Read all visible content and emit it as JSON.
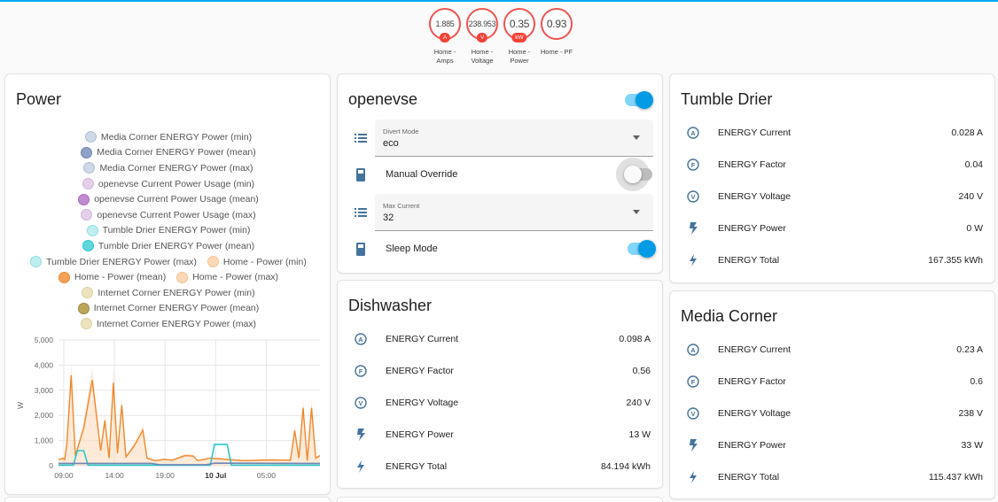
{
  "badges": [
    {
      "value": "1.885",
      "unit": "A",
      "label": "Home -\nAmps"
    },
    {
      "value": "238.953",
      "unit": "V",
      "label": "Home -\nVoltage"
    },
    {
      "value": "0.35",
      "unit": "kW",
      "label": "Home -\nPower"
    },
    {
      "value": "0.93",
      "unit": "",
      "label": "Home - PF"
    }
  ],
  "power": {
    "title": "Power",
    "legend": [
      {
        "label": "Media Corner ENERGY Power (min)",
        "fill": "#cfd8e6",
        "stroke": "#b0bfd6"
      },
      {
        "label": "Media Corner ENERGY Power (mean)",
        "fill": "#8ea2c6",
        "stroke": "#6f86b3"
      },
      {
        "label": "Media Corner ENERGY Power (max)",
        "fill": "#cfd8e6",
        "stroke": "#b0bfd6"
      },
      {
        "label": "openevse Current Power Usage (min)",
        "fill": "#e4cfe9",
        "stroke": "#d3b4dc"
      },
      {
        "label": "openevse Current Power Usage (mean)",
        "fill": "#c28ad0",
        "stroke": "#a96bb9"
      },
      {
        "label": "openevse Current Power Usage (max)",
        "fill": "#e4cfe9",
        "stroke": "#d3b4dc"
      },
      {
        "label": "Tumble Drier ENERGY Power (min)",
        "fill": "#bfeef0",
        "stroke": "#8fdde1"
      },
      {
        "label": "Tumble Drier ENERGY Power (mean)",
        "fill": "#5fd7dc",
        "stroke": "#2bc7cd"
      },
      {
        "label": "Tumble Drier ENERGY Power (max)",
        "fill": "#bfeef0",
        "stroke": "#8fdde1"
      },
      {
        "label": "Home - Power (min)",
        "fill": "#fbd8b8",
        "stroke": "#f7c190"
      },
      {
        "label": "Home - Power (mean)",
        "fill": "#f6a15a",
        "stroke": "#f0882e"
      },
      {
        "label": "Home - Power (max)",
        "fill": "#fbd8b8",
        "stroke": "#f7c190"
      },
      {
        "label": "Internet Corner ENERGY Power (min)",
        "fill": "#ece3bf",
        "stroke": "#ddd09a"
      },
      {
        "label": "Internet Corner ENERGY Power (mean)",
        "fill": "#bda55a",
        "stroke": "#9c873d"
      },
      {
        "label": "Internet Corner ENERGY Power (max)",
        "fill": "#ece3bf",
        "stroke": "#ddd09a"
      }
    ]
  },
  "chart_data": {
    "type": "line",
    "ylabel": "W",
    "ylim": [
      0,
      5000
    ],
    "yticks": [
      "0",
      "1,000",
      "2,000",
      "3,000",
      "4,000",
      "5,000"
    ],
    "xticks": [
      {
        "label": "09:00",
        "bold": false
      },
      {
        "label": "14:00",
        "bold": false
      },
      {
        "label": "19:00",
        "bold": false
      },
      {
        "label": "10 Jul",
        "bold": true
      },
      {
        "label": "05:00",
        "bold": false
      }
    ],
    "grid": true,
    "series": [
      {
        "name": "Home - Power (mean)",
        "color": "#f0882e",
        "points": [
          [
            0,
            250
          ],
          [
            0.05,
            260
          ],
          [
            0.1,
            300
          ],
          [
            0.15,
            250
          ],
          [
            0.2,
            900
          ],
          [
            0.3,
            3600
          ],
          [
            0.4,
            400
          ],
          [
            0.6,
            1500
          ],
          [
            0.8,
            3400
          ],
          [
            1.0,
            600
          ],
          [
            1.1,
            1800
          ],
          [
            1.2,
            300
          ],
          [
            1.3,
            3300
          ],
          [
            1.4,
            500
          ],
          [
            1.5,
            2400
          ],
          [
            1.6,
            350
          ],
          [
            1.8,
            800
          ],
          [
            2.0,
            1400
          ],
          [
            2.1,
            300
          ],
          [
            2.3,
            200
          ],
          [
            2.5,
            250
          ],
          [
            2.7,
            220
          ],
          [
            3.0,
            400
          ],
          [
            3.2,
            380
          ],
          [
            3.3,
            200
          ],
          [
            3.6,
            300
          ],
          [
            4.0,
            250
          ],
          [
            4.4,
            200
          ],
          [
            5.0,
            230
          ],
          [
            5.5,
            220
          ],
          [
            5.6,
            1400
          ],
          [
            5.7,
            300
          ],
          [
            5.8,
            2300
          ],
          [
            5.9,
            200
          ],
          [
            6.0,
            2300
          ],
          [
            6.1,
            300
          ],
          [
            6.2,
            400
          ]
        ]
      },
      {
        "name": "Tumble Drier ENERGY Power (mean)",
        "color": "#2bc7cd",
        "points": [
          [
            0,
            20
          ],
          [
            0.35,
            20
          ],
          [
            0.45,
            600
          ],
          [
            0.6,
            600
          ],
          [
            0.7,
            20
          ],
          [
            3.6,
            20
          ],
          [
            3.7,
            850
          ],
          [
            4.0,
            850
          ],
          [
            4.1,
            20
          ],
          [
            6.2,
            20
          ]
        ]
      },
      {
        "name": "Media Corner ENERGY Power (mean)",
        "color": "#6f86b3",
        "points": [
          [
            0,
            90
          ],
          [
            2.2,
            90
          ],
          [
            2.4,
            40
          ],
          [
            3.5,
            40
          ],
          [
            3.7,
            100
          ],
          [
            6.2,
            90
          ]
        ]
      }
    ]
  },
  "openevse": {
    "title": "openevse",
    "divert_label": "Divert Mode",
    "divert_value": "eco",
    "manual_label": "Manual Override",
    "max_label": "Max Current",
    "max_value": "32",
    "sleep_label": "Sleep Mode"
  },
  "dishwasher": {
    "title": "Dishwasher",
    "rows": [
      {
        "icon": "current-icon",
        "name": "ENERGY Current",
        "value": "0.098 A"
      },
      {
        "icon": "factor-icon",
        "name": "ENERGY Factor",
        "value": "0.56"
      },
      {
        "icon": "voltage-icon",
        "name": "ENERGY Voltage",
        "value": "240 V"
      },
      {
        "icon": "flash-icon",
        "name": "ENERGY Power",
        "value": "13 W"
      },
      {
        "icon": "lightning-icon",
        "name": "ENERGY Total",
        "value": "84.194 kWh"
      }
    ]
  },
  "tumble": {
    "title": "Tumble Drier",
    "rows": [
      {
        "icon": "current-icon",
        "name": "ENERGY Current",
        "value": "0.028 A"
      },
      {
        "icon": "factor-icon",
        "name": "ENERGY Factor",
        "value": "0.04"
      },
      {
        "icon": "voltage-icon",
        "name": "ENERGY Voltage",
        "value": "240 V"
      },
      {
        "icon": "flash-icon",
        "name": "ENERGY Power",
        "value": "0 W"
      },
      {
        "icon": "lightning-icon",
        "name": "ENERGY Total",
        "value": "167.355 kWh"
      }
    ]
  },
  "media": {
    "title": "Media Corner",
    "rows": [
      {
        "icon": "current-icon",
        "name": "ENERGY Current",
        "value": "0.23 A"
      },
      {
        "icon": "factor-icon",
        "name": "ENERGY Factor",
        "value": "0.6"
      },
      {
        "icon": "voltage-icon",
        "name": "ENERGY Voltage",
        "value": "238 V"
      },
      {
        "icon": "flash-icon",
        "name": "ENERGY Power",
        "value": "33 W"
      },
      {
        "icon": "lightning-icon",
        "name": "ENERGY Total",
        "value": "115.437 kWh"
      }
    ]
  }
}
